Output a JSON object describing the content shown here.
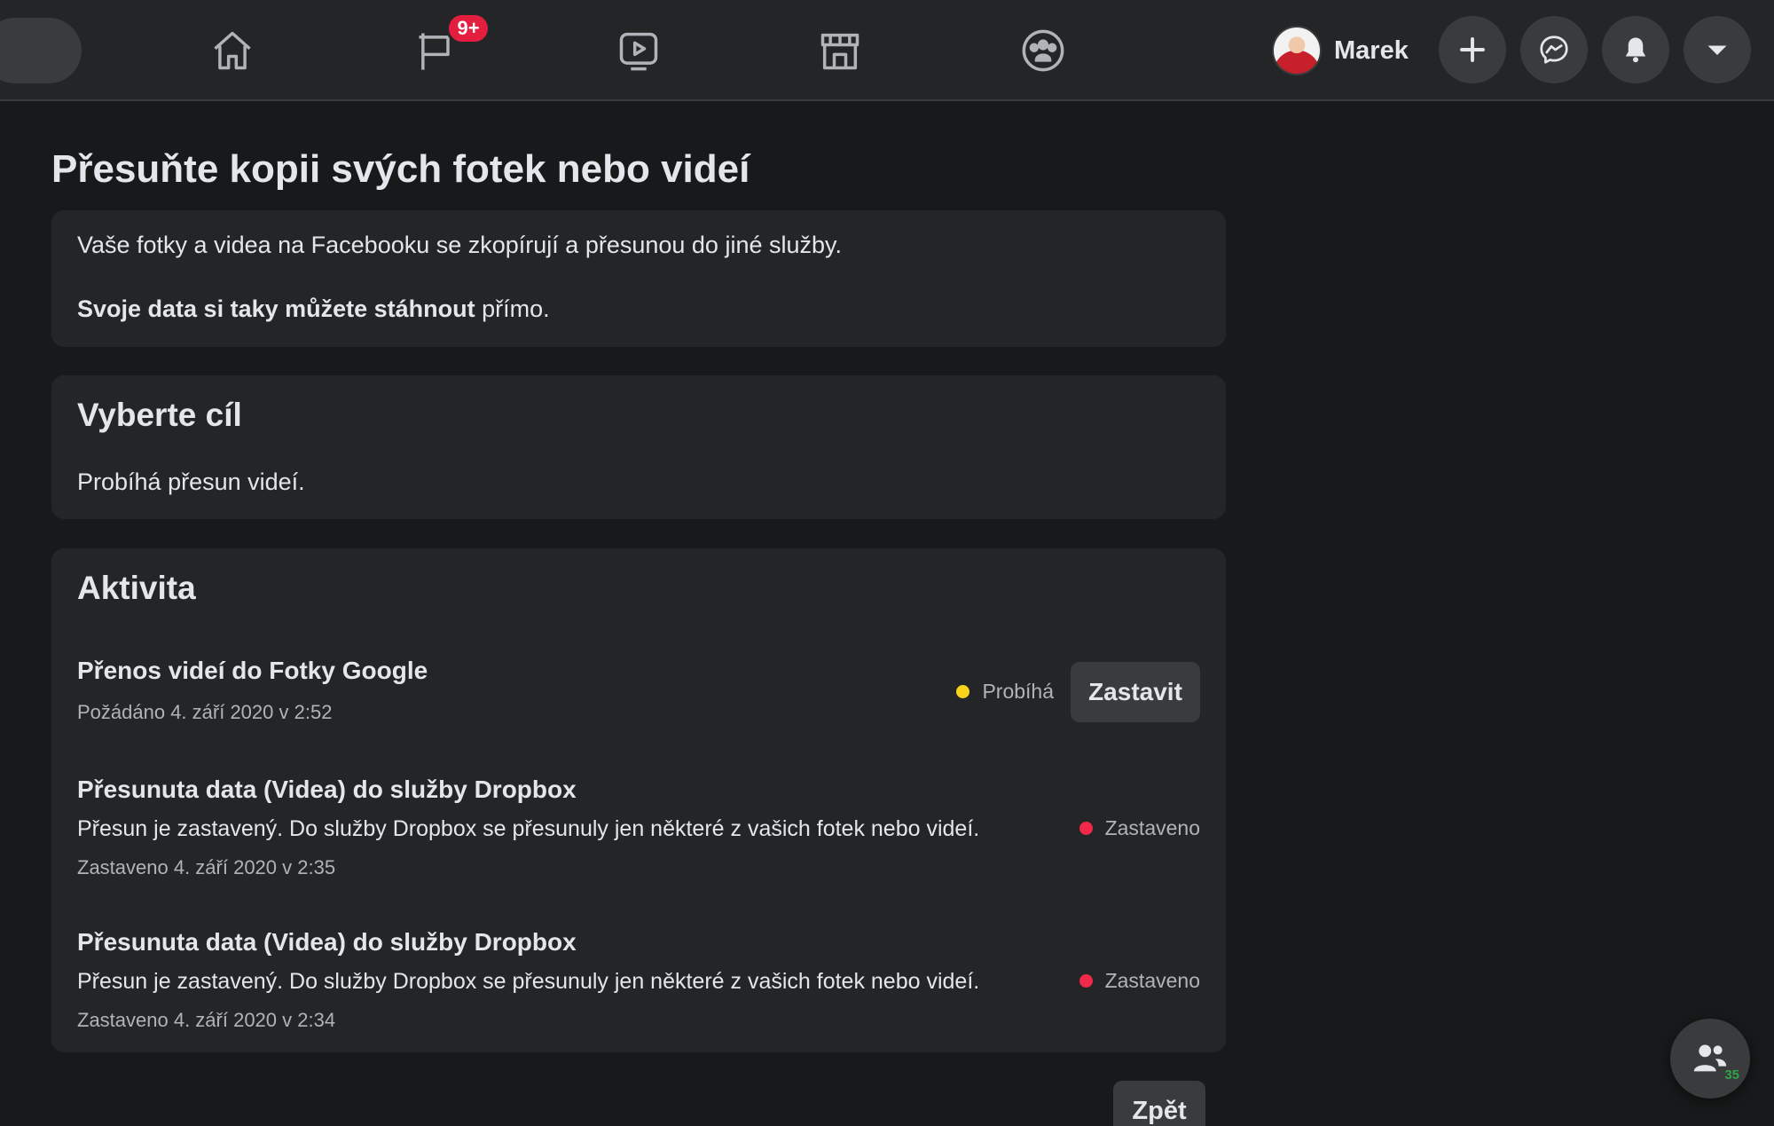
{
  "topbar": {
    "notifications_badge": "9+",
    "profile_name": "Marek"
  },
  "page": {
    "title": "Přesuňte kopii svých fotek nebo videí"
  },
  "intro": {
    "description": "Vaše fotky a videa na Facebooku se zkopírují a přesunou do jiné služby.",
    "download_link": "Svoje data si taky můžete stáhnout",
    "download_suffix": " přímo."
  },
  "target": {
    "heading": "Vyberte cíl",
    "status_text": "Probíhá přesun videí."
  },
  "activity": {
    "heading": "Aktivita",
    "items": [
      {
        "title": "Přenos videí do Fotky Google",
        "meta": "Požádáno 4. září 2020 v 2:52",
        "status": "Probíhá",
        "status_color": "#f7d31b",
        "action_label": "Zastavit"
      },
      {
        "title": "Přesunuta data (Videa) do služby Dropbox",
        "description": "Přesun je zastavený. Do služby Dropbox se přesunuly jen některé z vašich fotek nebo videí.",
        "meta": "Zastaveno 4. září 2020 v 2:35",
        "status": "Zastaveno",
        "status_color": "#f02849"
      },
      {
        "title": "Přesunuta data (Videa) do služby Dropbox",
        "description": "Přesun je zastavený. Do služby Dropbox se přesunuly jen některé z vašich fotek nebo videí.",
        "meta": "Zastaveno 4. září 2020 v 2:34",
        "status": "Zastaveno",
        "status_color": "#f02849"
      }
    ]
  },
  "footer": {
    "back_label": "Zpět"
  },
  "contacts": {
    "online_count": "35"
  },
  "colors": {
    "background": "#18191a",
    "surface": "#242526",
    "button": "#3a3b3c",
    "badge": "#e41e3f"
  },
  "icons": [
    "home-icon",
    "pages-flag-icon",
    "watch-video-icon",
    "marketplace-icon",
    "groups-icon",
    "plus-icon",
    "messenger-icon",
    "bell-icon",
    "caret-down-icon",
    "contacts-icon"
  ]
}
